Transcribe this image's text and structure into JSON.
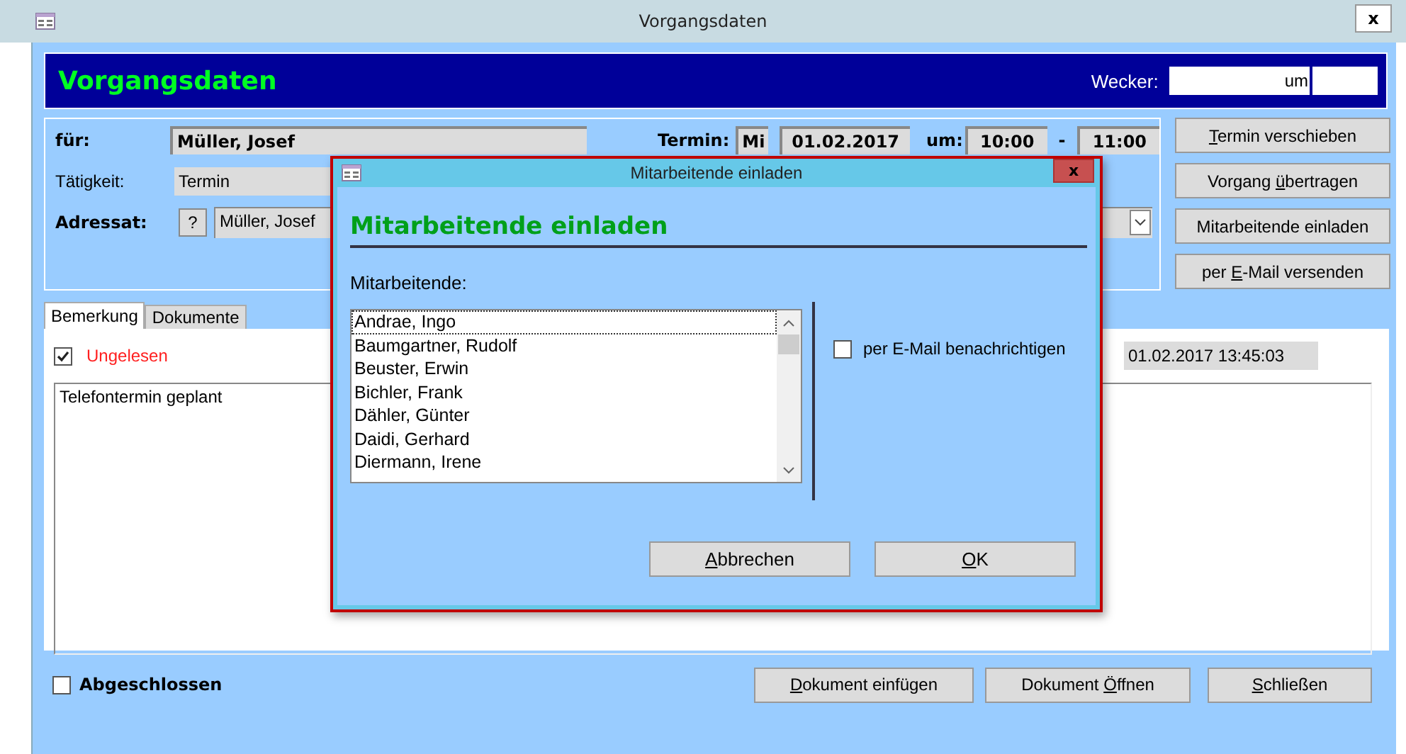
{
  "window": {
    "title": "Vorgangsdaten",
    "close": "x"
  },
  "header": {
    "title": "Vorgangsdaten",
    "alarm_label": "Wecker:",
    "alarm_time_label": "um"
  },
  "details": {
    "for_label": "für:",
    "for_value": "Müller, Josef",
    "appointment_label": "Termin:",
    "weekday": "Mi",
    "date": "01.02.2017",
    "time_label": "um:",
    "start": "10:00",
    "separator": "-",
    "end": "11:00",
    "activity_label": "Tätigkeit:",
    "activity_value": "Termin",
    "addressee_label": "Adressat:",
    "lookup_button": "?",
    "addressee_value": "Müller, Josef"
  },
  "actions": [
    {
      "key": "T",
      "after": "ermin verschieben"
    },
    {
      "before": "Vorgang ",
      "key": "ü",
      "after": "bertragen"
    },
    {
      "before": "Mitarbeitende einladen"
    },
    {
      "before": "per ",
      "key": "E",
      "after": "-Mail versenden"
    }
  ],
  "tabs": [
    {
      "label": "Bemerkung",
      "selected": true
    },
    {
      "label": "Dokumente",
      "selected": false
    }
  ],
  "note": {
    "unread": {
      "label": "Ungelesen",
      "checked": true
    },
    "timestamp": "01.02.2017 13:45:03",
    "text": "Telefontermin geplant"
  },
  "footer": {
    "closed": {
      "label": "Abgeschlossen",
      "checked": false
    },
    "buttons": [
      {
        "key": "D",
        "after": "okument einfügen"
      },
      {
        "before": "Dokument ",
        "key": "Ö",
        "after": "ffnen"
      },
      {
        "key": "S",
        "after": "chließen"
      }
    ]
  },
  "dialog": {
    "title": "Mitarbeitende einladen",
    "close": "x",
    "heading": "Mitarbeitende einladen",
    "list_label": "Mitarbeitende:",
    "employees": [
      {
        "name": "Andrae, Ingo",
        "selected": false,
        "focused": true
      },
      {
        "name": "Baumgartner, Rudolf",
        "selected": false,
        "focused": false
      },
      {
        "name": "Beuster, Erwin",
        "selected": false,
        "focused": false
      },
      {
        "name": "Bichler, Frank",
        "selected": false,
        "focused": false
      },
      {
        "name": "Dähler, Günter",
        "selected": false,
        "focused": false
      },
      {
        "name": "Daidi, Gerhard",
        "selected": false,
        "focused": false
      },
      {
        "name": "Diermann, Irene",
        "selected": false,
        "focused": false
      }
    ],
    "notify": {
      "label": "per E-Mail benachrichtigen",
      "checked": false
    },
    "buttons": [
      {
        "key": "A",
        "after": "bbrechen"
      },
      {
        "key": "O",
        "after": "K"
      }
    ]
  }
}
